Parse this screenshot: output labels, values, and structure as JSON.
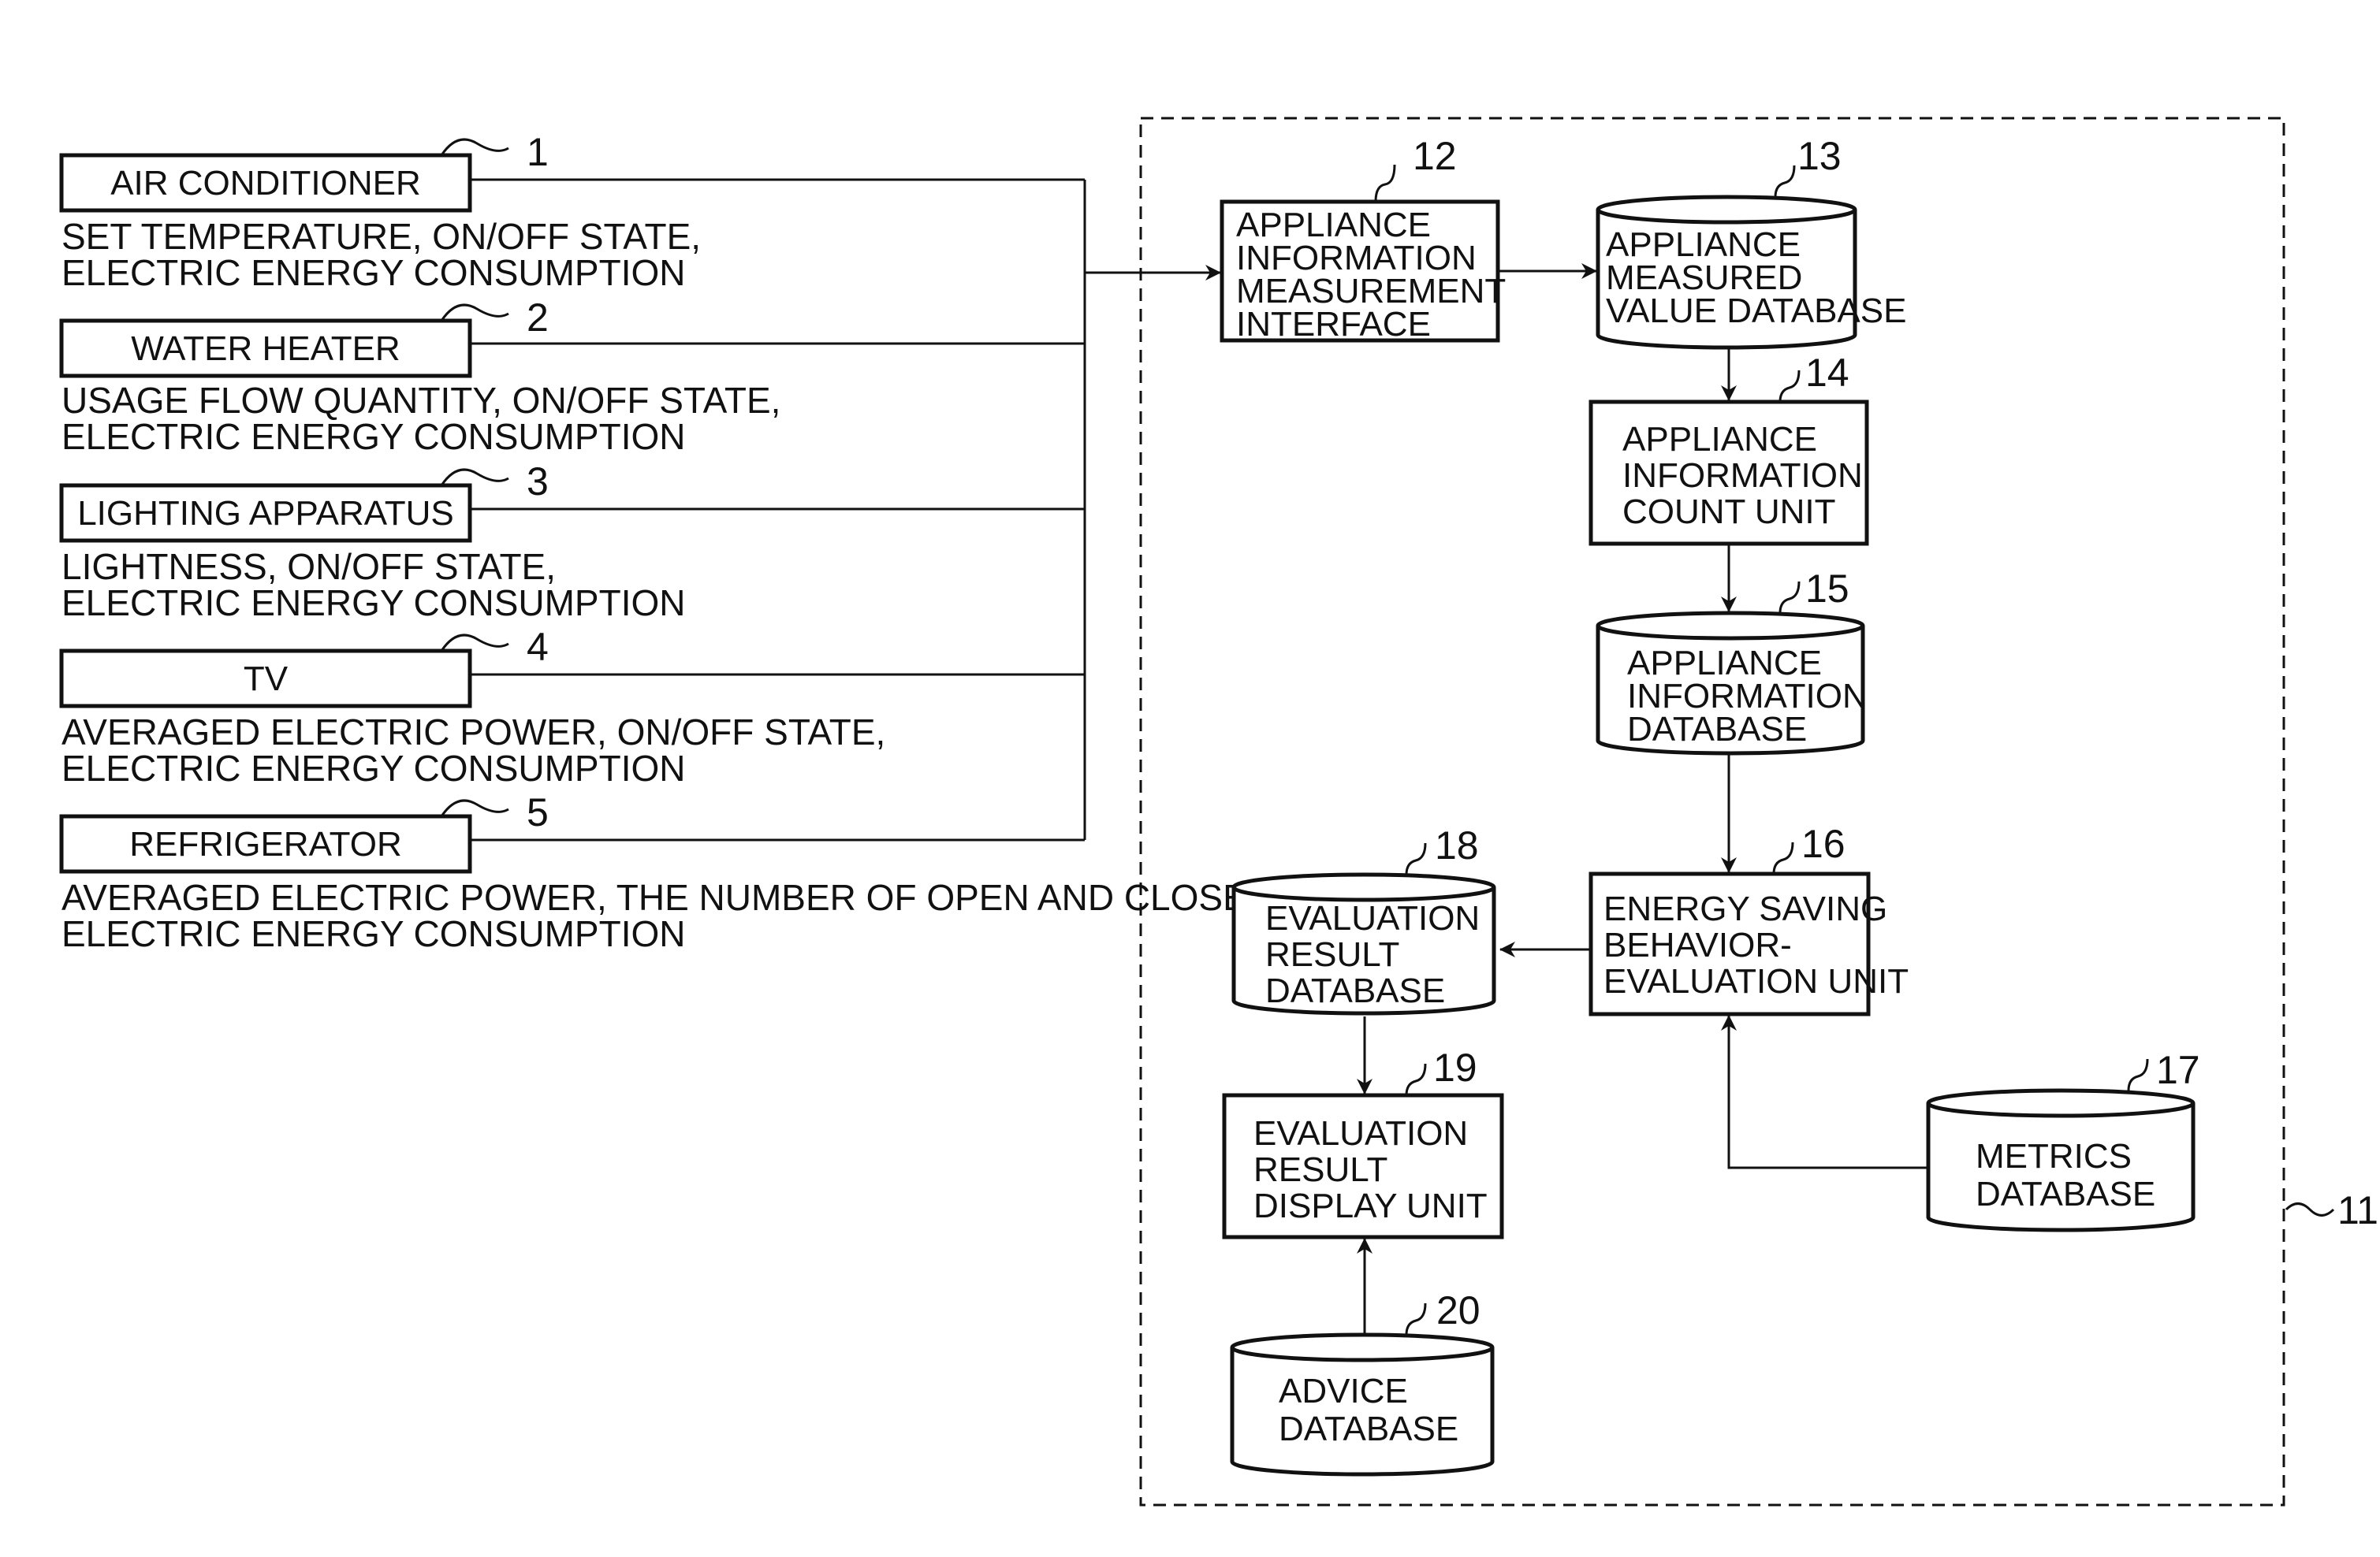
{
  "appliances": [
    {
      "id": "1",
      "name": "AIR CONDITIONER",
      "desc": [
        "SET TEMPERATURE, ON/OFF STATE,",
        "ELECTRIC ENERGY CONSUMPTION"
      ]
    },
    {
      "id": "2",
      "name": "WATER HEATER",
      "desc": [
        "USAGE FLOW QUANTITY, ON/OFF STATE,",
        "ELECTRIC ENERGY CONSUMPTION"
      ]
    },
    {
      "id": "3",
      "name": "LIGHTING APPARATUS",
      "desc": [
        "LIGHTNESS, ON/OFF STATE,",
        "ELECTRIC ENERGY CONSUMPTION"
      ]
    },
    {
      "id": "4",
      "name": "TV",
      "desc": [
        "AVERAGED ELECTRIC POWER, ON/OFF STATE,",
        "ELECTRIC ENERGY CONSUMPTION"
      ]
    },
    {
      "id": "5",
      "name": "REFRIGERATOR",
      "desc": [
        "AVERAGED ELECTRIC POWER, THE NUMBER OF OPEN AND CLOSE,",
        "ELECTRIC ENERGY CONSUMPTION"
      ]
    }
  ],
  "system": {
    "id": "11"
  },
  "blocks": {
    "b12": {
      "id": "12",
      "type": "unit",
      "lines": [
        "APPLIANCE",
        "INFORMATION",
        "MEASUREMENT",
        "INTERFACE"
      ]
    },
    "b13": {
      "id": "13",
      "type": "database",
      "lines": [
        "APPLIANCE",
        "MEASURED",
        "VALUE DATABASE"
      ]
    },
    "b14": {
      "id": "14",
      "type": "unit",
      "lines": [
        "APPLIANCE",
        "INFORMATION",
        "COUNT UNIT"
      ]
    },
    "b15": {
      "id": "15",
      "type": "database",
      "lines": [
        "APPLIANCE",
        "INFORMATION",
        "DATABASE"
      ]
    },
    "b16": {
      "id": "16",
      "type": "unit",
      "lines": [
        "ENERGY SAVING",
        "BEHAVIOR-",
        "EVALUATION UNIT"
      ]
    },
    "b17": {
      "id": "17",
      "type": "database",
      "lines": [
        "METRICS",
        "DATABASE"
      ]
    },
    "b18": {
      "id": "18",
      "type": "database",
      "lines": [
        "EVALUATION",
        "RESULT",
        "DATABASE"
      ]
    },
    "b19": {
      "id": "19",
      "type": "unit",
      "lines": [
        "EVALUATION",
        "RESULT",
        "DISPLAY UNIT"
      ]
    },
    "b20": {
      "id": "20",
      "type": "database",
      "lines": [
        "ADVICE",
        "DATABASE"
      ]
    }
  }
}
